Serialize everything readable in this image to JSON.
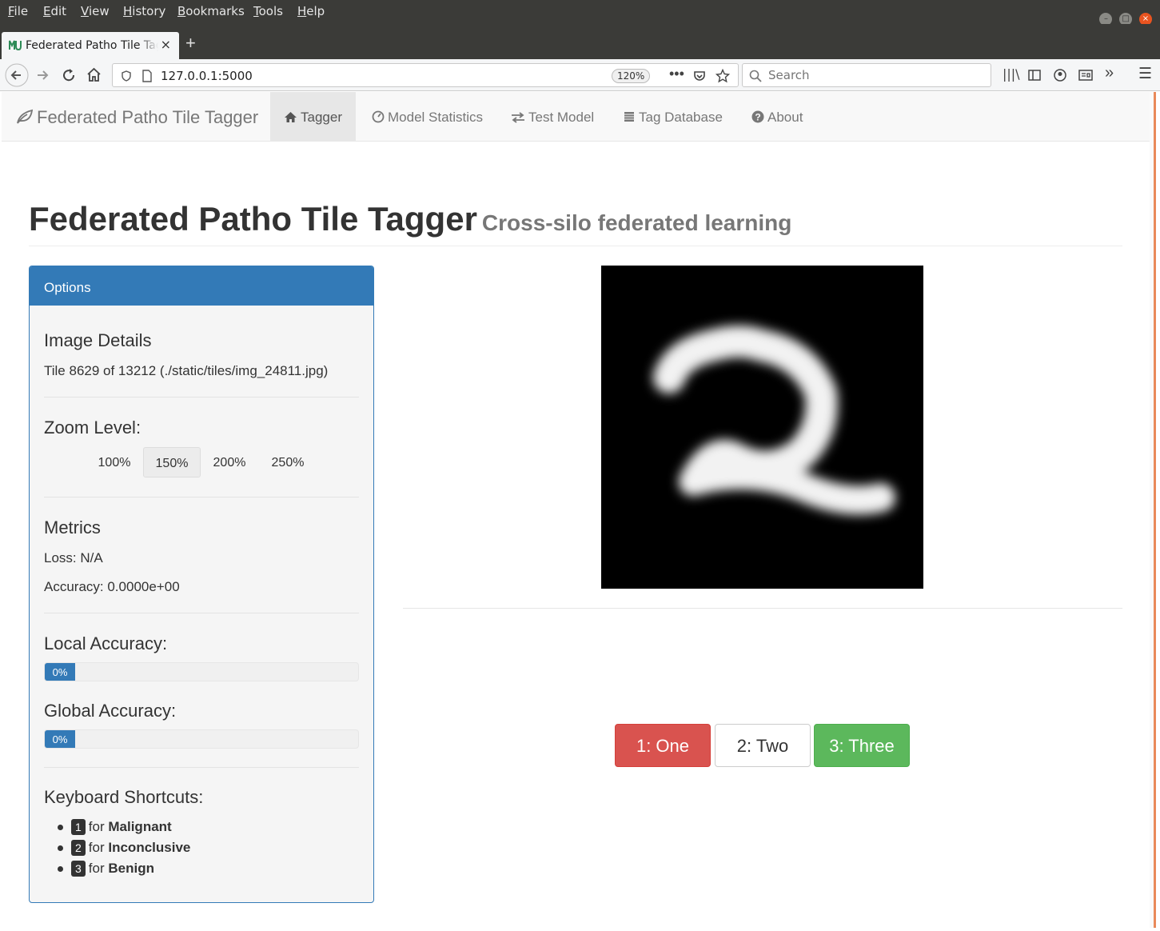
{
  "browser": {
    "menu": [
      "File",
      "Edit",
      "View",
      "History",
      "Bookmarks",
      "Tools",
      "Help"
    ],
    "tab_title": "Federated Patho Tile Tagger",
    "url": "127.0.0.1:5000",
    "zoom": "120%",
    "search_placeholder": "Search"
  },
  "navbar": {
    "brand": "Federated Patho Tile Tagger",
    "items": [
      "Tagger",
      "Model Statistics",
      "Test Model",
      "Tag Database",
      "About"
    ],
    "active": "Tagger"
  },
  "header": {
    "title": "Federated Patho Tile Tagger",
    "subtitle": "Cross-silo federated learning"
  },
  "options": {
    "heading": "Options",
    "image_details_title": "Image Details",
    "image_details": "Tile 8629 of 13212 (./static/tiles/img_24811.jpg)",
    "zoom_title": "Zoom Level:",
    "zoom_levels": [
      "100%",
      "150%",
      "200%",
      "250%"
    ],
    "zoom_selected": "150%",
    "metrics_title": "Metrics",
    "loss": "Loss: N/A",
    "accuracy": "Accuracy: 0.0000e+00",
    "local_accuracy_title": "Local Accuracy:",
    "local_accuracy": "0%",
    "global_accuracy_title": "Global Accuracy:",
    "global_accuracy": "0%",
    "shortcuts_title": "Keyboard Shortcuts:",
    "shortcuts": [
      {
        "key": "1",
        "text": "for",
        "label": "Malignant"
      },
      {
        "key": "2",
        "text": "for",
        "label": "Inconclusive"
      },
      {
        "key": "3",
        "text": "for",
        "label": "Benign"
      }
    ]
  },
  "tag_buttons": [
    "1: One",
    "2: Two",
    "3: Three"
  ],
  "colors": {
    "primary": "#337ab7",
    "danger": "#d9534f",
    "success": "#5cb85c"
  }
}
